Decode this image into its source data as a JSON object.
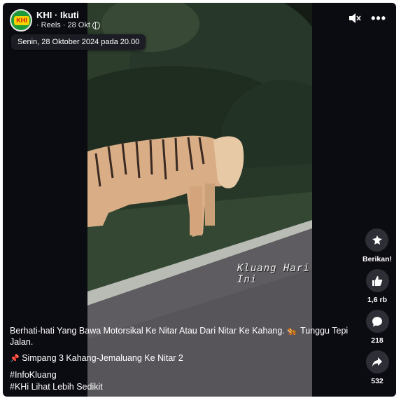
{
  "page": {
    "author": "KHI",
    "follow_label": "Ikuti",
    "separator": "·",
    "reels_label": "Reels",
    "date_short": "28 Okt",
    "avatar_logo": "KHI"
  },
  "tooltip": {
    "text": "Senin, 28 Oktober 2024 pada 20.00"
  },
  "video": {
    "watermark": "Kluang Hari Ini"
  },
  "actions": {
    "gift_label": "Berikan!",
    "like_count": "1,6 rb",
    "comment_count": "218",
    "share_count": "532"
  },
  "caption": {
    "line1": "Berhati-hati Yang Bawa Motorsikal Ke Nitar Atau Dari Nitar Ke Kahang. 🐅 Tunggu Tepi Jalan.",
    "location": "Simpang 3 Kahang-Jemaluang Ke Nitar 2",
    "hashtag1": "#InfoKluang",
    "hashtag2": "#KHi Lihat Lebih Sedikit"
  },
  "icons": [
    "mute-icon",
    "more-icon",
    "gift-icon",
    "like-icon",
    "comment-icon",
    "share-icon",
    "pin-icon",
    "globe-icon"
  ],
  "colors": {
    "background": "#0b0b12",
    "button": "#2e2f36",
    "avatar": "#1f9a3a"
  }
}
